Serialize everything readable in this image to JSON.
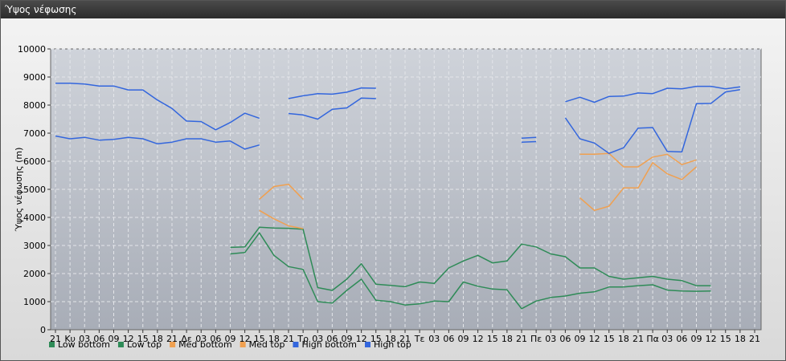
{
  "window": {
    "title": "Ύψος νέφωσης"
  },
  "chart_data": {
    "type": "line",
    "ylabel": "Ύψος νέφωσης (m)",
    "ylim": [
      0,
      10000
    ],
    "yticks": [
      0,
      1000,
      2000,
      3000,
      4000,
      5000,
      6000,
      7000,
      8000,
      9000,
      10000
    ],
    "xticks": [
      "21",
      "Κυ",
      "03",
      "06",
      "09",
      "12",
      "15",
      "18",
      "21",
      "Δε",
      "03",
      "06",
      "09",
      "12",
      "15",
      "18",
      "21",
      "Τρ",
      "03",
      "06",
      "09",
      "12",
      "15",
      "18",
      "21",
      "Τε",
      "03",
      "06",
      "09",
      "12",
      "15",
      "18",
      "21",
      "Πε",
      "03",
      "06",
      "09",
      "12",
      "15",
      "18",
      "21",
      "Πα",
      "03",
      "06",
      "09",
      "12",
      "15",
      "18",
      "21"
    ],
    "grid": true,
    "legend_position": "bottom",
    "series": [
      {
        "name": "Low bottom",
        "color": "#2e8b57",
        "values": [
          null,
          null,
          null,
          null,
          null,
          null,
          null,
          null,
          null,
          null,
          null,
          null,
          2700,
          2750,
          3450,
          2650,
          2250,
          2150,
          1000,
          950,
          1400,
          1800,
          1050,
          1000,
          880,
          920,
          1020,
          1000,
          1700,
          1550,
          1450,
          1420,
          750,
          1020,
          1150,
          1200,
          1300,
          1350,
          1520,
          1520,
          1570,
          1600,
          1410,
          1380,
          1370,
          1380,
          null,
          null,
          null
        ]
      },
      {
        "name": "Low top",
        "color": "#2e8b57",
        "values": [
          null,
          null,
          null,
          null,
          null,
          null,
          null,
          null,
          null,
          null,
          null,
          null,
          2930,
          2950,
          3650,
          3620,
          3610,
          3580,
          1500,
          1400,
          1800,
          2350,
          1620,
          1580,
          1530,
          1700,
          1650,
          2200,
          2450,
          2650,
          2380,
          2450,
          3050,
          2950,
          2700,
          2600,
          2200,
          2200,
          1900,
          1800,
          1850,
          1900,
          1800,
          1750,
          1570,
          1570,
          null,
          null,
          null
        ]
      },
      {
        "name": "Med bottom",
        "color": "#f0a050",
        "values": [
          null,
          null,
          null,
          null,
          null,
          null,
          null,
          null,
          null,
          null,
          null,
          null,
          null,
          null,
          4250,
          3950,
          3700,
          3600,
          null,
          null,
          null,
          null,
          null,
          null,
          null,
          null,
          null,
          null,
          null,
          null,
          null,
          null,
          null,
          null,
          null,
          null,
          4700,
          4250,
          4400,
          5050,
          5050,
          5950,
          5550,
          5350,
          5800,
          null,
          null,
          null,
          null
        ]
      },
      {
        "name": "Med top",
        "color": "#f0a050",
        "values": [
          null,
          null,
          null,
          null,
          null,
          null,
          null,
          null,
          null,
          null,
          null,
          null,
          null,
          null,
          4650,
          5100,
          5180,
          4650,
          null,
          null,
          null,
          null,
          null,
          null,
          null,
          null,
          null,
          null,
          null,
          null,
          null,
          null,
          null,
          null,
          null,
          null,
          6250,
          6250,
          6280,
          5800,
          5800,
          6150,
          6250,
          5880,
          6050,
          null,
          null,
          null,
          null
        ]
      },
      {
        "name": "High bottom",
        "color": "#3366dd",
        "values": [
          6900,
          6800,
          6850,
          6750,
          6780,
          6850,
          6800,
          6620,
          6680,
          6800,
          6800,
          6680,
          6720,
          6430,
          6580,
          null,
          7700,
          7650,
          7500,
          7850,
          7900,
          8250,
          8230,
          null,
          null,
          null,
          null,
          null,
          null,
          null,
          null,
          null,
          6680,
          6700,
          null,
          7550,
          6800,
          6650,
          6280,
          6480,
          7180,
          7200,
          6350,
          6330,
          8050,
          8060,
          8470,
          8550,
          null
        ]
      },
      {
        "name": "High top",
        "color": "#3366dd",
        "values": [
          8780,
          8780,
          8750,
          8680,
          8680,
          8540,
          8540,
          8180,
          7880,
          7430,
          7410,
          7120,
          7380,
          7710,
          7530,
          null,
          8230,
          8330,
          8410,
          8390,
          8460,
          8610,
          8600,
          null,
          null,
          null,
          null,
          null,
          null,
          null,
          null,
          null,
          6820,
          6850,
          null,
          8120,
          8280,
          8100,
          8310,
          8320,
          8430,
          8410,
          8600,
          8580,
          8670,
          8670,
          8580,
          8650,
          null
        ]
      }
    ]
  }
}
